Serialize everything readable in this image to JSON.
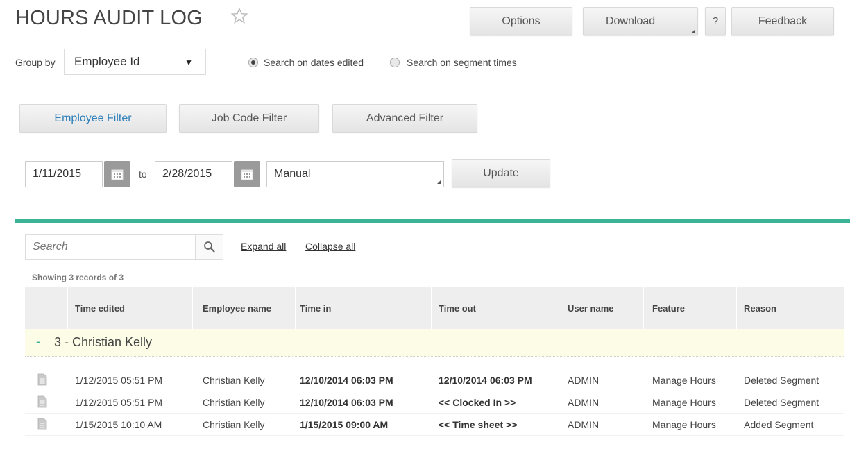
{
  "header": {
    "title": "HOURS AUDIT LOG",
    "buttons": {
      "options": "Options",
      "download": "Download",
      "help": "?",
      "feedback": "Feedback"
    }
  },
  "controls": {
    "group_by_label": "Group by",
    "group_by_value": "Employee Id",
    "radio_dates_edited": "Search on dates edited",
    "radio_segment_times": "Search on segment times",
    "radio_selected": "dates_edited"
  },
  "filters": {
    "employee": "Employee Filter",
    "job_code": "Job Code Filter",
    "advanced": "Advanced Filter"
  },
  "date_range": {
    "from": "1/11/2015",
    "to_label": "to",
    "to": "2/28/2015",
    "mode": "Manual",
    "update_label": "Update"
  },
  "search": {
    "placeholder": "Search",
    "expand_all": "Expand all",
    "collapse_all": "Collapse all",
    "showing": "Showing 3 records of 3"
  },
  "table": {
    "columns": [
      "Time edited",
      "Employee name",
      "Time in",
      "Time out",
      "User name",
      "Feature",
      "Reason"
    ],
    "group_title": "3 - Christian Kelly",
    "group_toggle": "-",
    "rows": [
      [
        "1/12/2015 05:51 PM",
        "Christian Kelly",
        "12/10/2014 06:03 PM",
        "12/10/2014 06:03 PM",
        "ADMIN",
        "Manage Hours",
        "Deleted Segment"
      ],
      [
        "1/12/2015 05:51 PM",
        "Christian Kelly",
        "12/10/2014 06:03 PM",
        "<< Clocked In >>",
        "ADMIN",
        "Manage Hours",
        "Deleted Segment"
      ],
      [
        "1/15/2015 10:10 AM",
        "Christian Kelly",
        "1/15/2015 09:00 AM",
        "<< Time sheet >>",
        "ADMIN",
        "Manage Hours",
        "Added Segment"
      ]
    ]
  },
  "colors": {
    "accent": "#3ab495",
    "link_blue": "#2c7fb8",
    "header_bg": "#eeeeee",
    "group_bg": "#fdfde7"
  }
}
